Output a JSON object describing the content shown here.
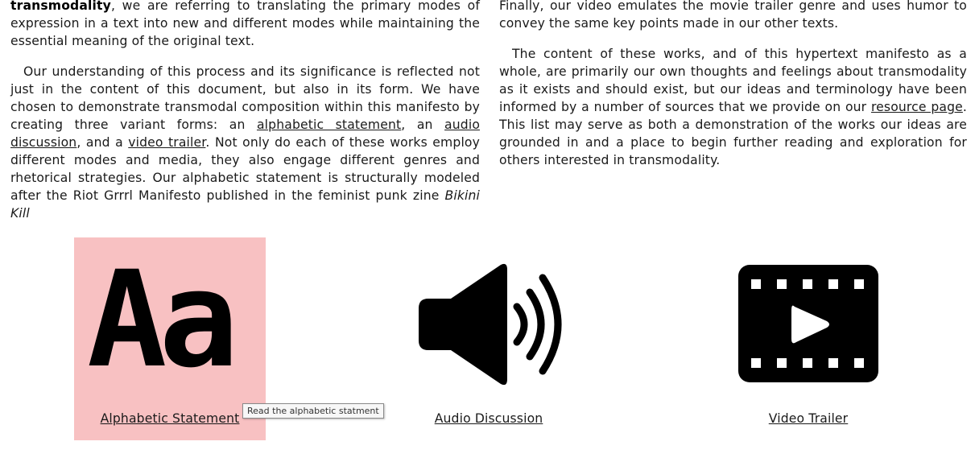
{
  "left_column": {
    "p1": {
      "term": "transmodality",
      "rest": ", we are referring to translating the primary modes of expression in a text into new and different modes while maintaining the essential meaning of the original text."
    },
    "p2": {
      "t1": "Our understanding of this process and its significance is reflected not just in the content of this document, but also in its form. We have chosen to demonstrate transmodal composition within this manifesto by creating three variant forms: an ",
      "link1": "alphabetic statement",
      "t2": ", an ",
      "link2": "audio discussion",
      "t3": ", and a ",
      "link3": "video trailer",
      "t4": ". Not only do each of these works employ different modes and media, they also engage different genres and rhetorical strategies. Our alphabetic statement is structurally modeled after the Riot Grrrl Manifesto published in the feminist punk zine ",
      "italic": "Bikini Kill"
    }
  },
  "right_column": {
    "p1": "Finally, our video emulates the movie trailer genre and uses humor to convey the same key points made in our other texts.",
    "p2": {
      "t1": "The content of these works, and of this hypertext manifesto as a whole, are primarily our own thoughts and feelings about transmodality as it exists and should exist, but our ideas and terminology have been informed by a number of sources that we provide on our ",
      "link": "resource page",
      "t2": ". This list may serve as both a demonstration of the works our ideas are grounded in and a place to begin further reading and exploration for others interested in transmodality."
    }
  },
  "cards": [
    {
      "label": "Alphabetic Statement",
      "icon": "letters-aa-icon",
      "glyph": "Aa",
      "hovered": true
    },
    {
      "label": "Audio Discussion",
      "icon": "speaker-icon"
    },
    {
      "label": "Video Trailer",
      "icon": "film-play-icon"
    }
  ],
  "tooltip": "Read the alphabetic statment",
  "colors": {
    "hover_bg": "#f8c1c2",
    "text": "#1a1a1a",
    "icon": "#000000"
  }
}
